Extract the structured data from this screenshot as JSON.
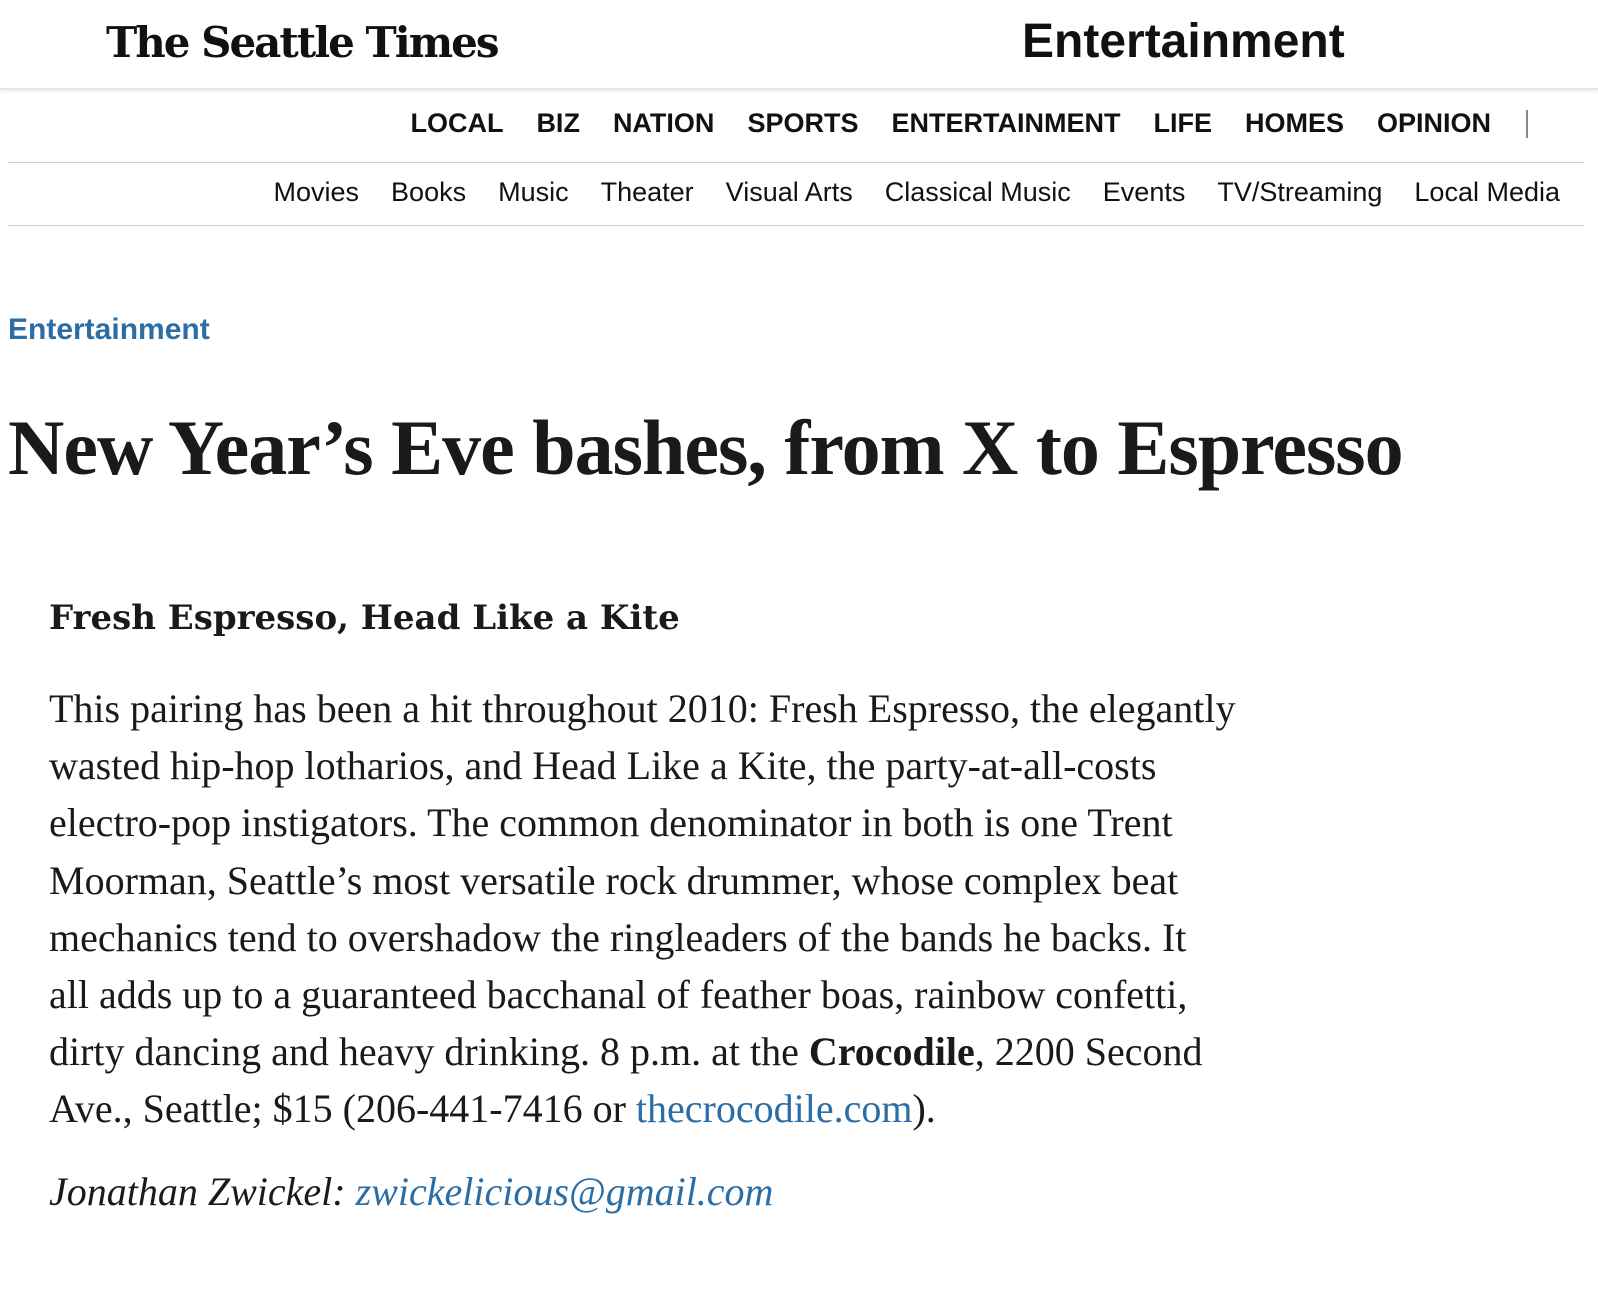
{
  "header": {
    "masthead": "The Seattle Times",
    "section_title": "Entertainment"
  },
  "main_nav": [
    "LOCAL",
    "BIZ",
    "NATION",
    "SPORTS",
    "ENTERTAINMENT",
    "LIFE",
    "HOMES",
    "OPINION"
  ],
  "sub_nav": [
    "Movies",
    "Books",
    "Music",
    "Theater",
    "Visual Arts",
    "Classical Music",
    "Events",
    "TV/Streaming",
    "Local Media"
  ],
  "article": {
    "kicker": "Entertainment",
    "headline": "New Year’s Eve bashes, from X to Espresso",
    "subhead": "Fresh Espresso, Head Like a Kite",
    "lines": [
      "This pairing has been a hit throughout 2010: Fresh Espresso, the elegantly",
      "wasted hip-hop lotharios, and Head Like a Kite, the party-at-all-costs",
      "electro-pop instigators. The common denominator in both is one Trent",
      "Moorman, Seattle’s most versatile rock drummer, whose complex beat",
      "mechanics tend to overshadow the ringleaders of the bands he backs. It",
      "all adds up to a guaranteed bacchanal of feather boas, rainbow confetti,"
    ],
    "line7_pre": "dirty dancing and heavy drinking. 8 p.m. at the ",
    "venue": "Crocodile",
    "line7_post": ", 2200 Second",
    "line8_pre": "Ave., Seattle; $15 (206-441-7416 or ",
    "venue_link": "thecrocodile.com",
    "line8_post": ").",
    "byline_author": "Jonathan Zwickel: ",
    "byline_email": "zwickelicious@gmail.com"
  }
}
